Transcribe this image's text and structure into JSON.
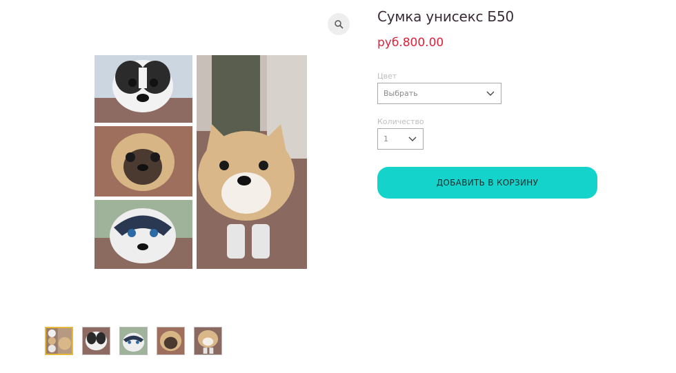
{
  "product": {
    "title": "Сумка унисекс Б50",
    "price": "руб.800.00"
  },
  "options": {
    "color_label": "Цвет",
    "color_value": "Выбрать",
    "quantity_label": "Количество",
    "quantity_value": "1"
  },
  "actions": {
    "add_to_cart": "ДОБАВИТЬ В КОРЗИНУ"
  },
  "gallery": {
    "thumbnail_count": 5,
    "selected_index": 0
  },
  "colors": {
    "price": "#e0203a",
    "button": "#13d3cb",
    "selected_thumb_border": "#e7b93a"
  }
}
